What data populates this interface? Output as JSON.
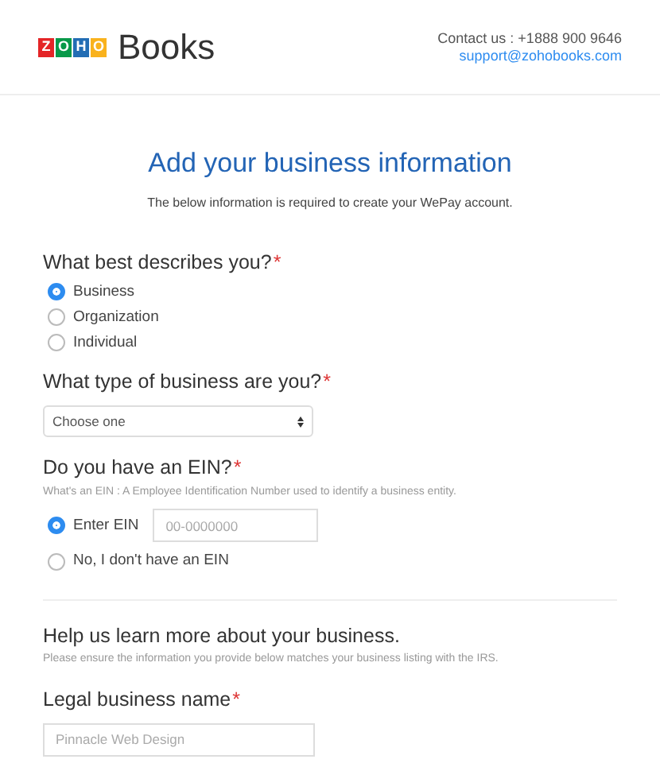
{
  "header": {
    "logo_letters": [
      {
        "text": "Z",
        "color": "#e42527"
      },
      {
        "text": "O",
        "color": "#089949"
      },
      {
        "text": "H",
        "color": "#226db4"
      },
      {
        "text": "O",
        "color": "#f9b21d"
      }
    ],
    "product": "Books",
    "contact": "Contact us : +1888 900 9646",
    "email": "support@zohobooks.com"
  },
  "required_mark": "*",
  "title": "Add your business information",
  "subtitle": "The below information is required to create your WePay account.",
  "describe": {
    "label": "What best describes you?",
    "required": true,
    "options": [
      {
        "label": "Business",
        "selected": true
      },
      {
        "label": "Organization",
        "selected": false
      },
      {
        "label": "Individual",
        "selected": false
      }
    ]
  },
  "business_type": {
    "label": "What type of business are you?",
    "required": true,
    "value": "Choose one"
  },
  "ein": {
    "label": "Do you have an EIN?",
    "required": true,
    "hint": "What's an EIN : A Employee Identification Number used to identify a business entity.",
    "options": [
      {
        "label": "Enter EIN",
        "selected": true,
        "placeholder": "00-0000000"
      },
      {
        "label": "No, I don't have an EIN",
        "selected": false
      }
    ]
  },
  "more": {
    "heading": "Help us learn more about your business.",
    "hint": "Please ensure the information you provide below matches your business listing with the IRS.",
    "legal_name": {
      "label": "Legal business name",
      "required": true,
      "placeholder": "Pinnacle Web Design"
    }
  }
}
